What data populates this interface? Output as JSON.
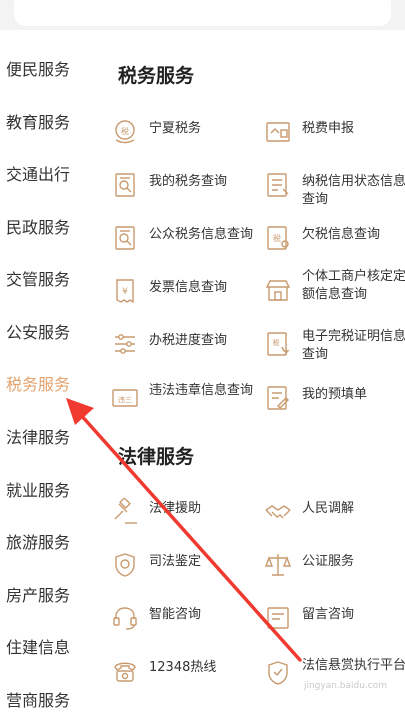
{
  "sidebar": {
    "items": [
      {
        "label": "便民服务"
      },
      {
        "label": "教育服务"
      },
      {
        "label": "交通出行"
      },
      {
        "label": "民政服务"
      },
      {
        "label": "交管服务"
      },
      {
        "label": "公安服务"
      },
      {
        "label": "税务服务"
      },
      {
        "label": "法律服务"
      },
      {
        "label": "就业服务"
      },
      {
        "label": "旅游服务"
      },
      {
        "label": "房产服务"
      },
      {
        "label": "住建信息"
      },
      {
        "label": "营商服务"
      }
    ],
    "active_label": "税务服务"
  },
  "tax": {
    "title": "税务服务",
    "items": [
      {
        "label": "宁夏税务",
        "icon": "tax-seal-icon"
      },
      {
        "label": "税费申报",
        "icon": "declaration-icon"
      },
      {
        "label": "我的税务查询",
        "icon": "document-search-icon"
      },
      {
        "label": "纳税信用状态信息查询",
        "icon": "list-document-icon"
      },
      {
        "label": "公众税务信息查询",
        "icon": "document-search-icon"
      },
      {
        "label": "欠税信息查询",
        "icon": "tax-document-icon"
      },
      {
        "label": "发票信息查询",
        "icon": "invoice-icon"
      },
      {
        "label": "个体工商户核定定额信息查询",
        "icon": "shop-icon"
      },
      {
        "label": "办税进度查询",
        "icon": "sliders-icon"
      },
      {
        "label": "电子完税证明信息查询",
        "icon": "certificate-icon"
      },
      {
        "label": "违法违章信息查询",
        "icon": "violation-icon"
      },
      {
        "label": "我的预填单",
        "icon": "edit-form-icon"
      }
    ]
  },
  "law": {
    "title": "法律服务",
    "items": [
      {
        "label": "法律援助",
        "icon": "gavel-icon"
      },
      {
        "label": "人民调解",
        "icon": "handshake-icon"
      },
      {
        "label": "司法鉴定",
        "icon": "shield-badge-icon"
      },
      {
        "label": "公证服务",
        "icon": "scales-icon"
      },
      {
        "label": "智能咨询",
        "icon": "headset-icon"
      },
      {
        "label": "留言咨询",
        "icon": "message-icon"
      },
      {
        "label": "12348热线",
        "icon": "phone-icon"
      },
      {
        "label": "法信悬赏执行平台",
        "icon": "shield-icon"
      }
    ]
  },
  "colors": {
    "accent": "#e2a36f",
    "icon": "#c99a6e",
    "arrow": "#f03a2f"
  },
  "watermark": "jingyan.baidu.com"
}
